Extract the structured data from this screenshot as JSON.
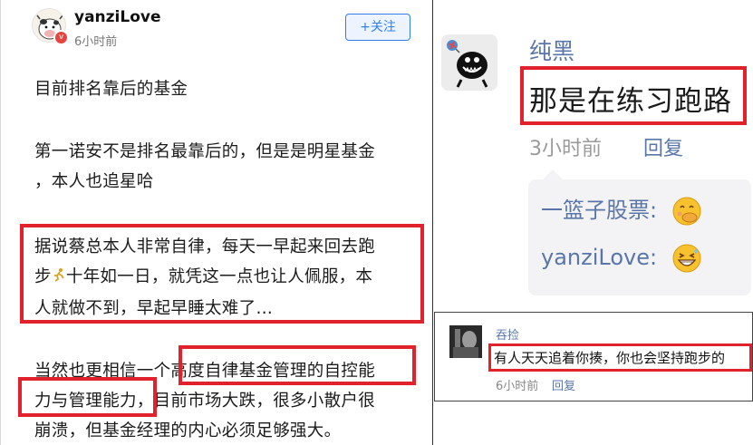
{
  "left_post": {
    "username": "yanziLove",
    "time": "6小时前",
    "follow_label": "+关注",
    "badge": "v",
    "paragraphs": {
      "p1": "目前排名靠后的基金",
      "p2_line1": "第一诺安不是排名最靠后的，但是是明星基金",
      "p2_line2": "，本人也追星哈",
      "p3_line1": "据说蔡总本人非常自律，每天一早起来回去跑",
      "p3_line2_a": "步",
      "p3_line2_b": "十年如一日，就凭这一点也让人佩服，本",
      "p3_line3": "人就做不到，早起早睡太难了…",
      "p4_line1": "当然也更相信一个高度自律基金管理的自控能",
      "p4_line2": "力与管理能力，目前市场大跌，很多小散户很",
      "p4_line3": "崩溃，但基金经理的内心必须足够强大。"
    },
    "icons": {
      "runner": "running-person-emoji"
    }
  },
  "comment_main": {
    "name": "纯黑",
    "text": "那是在练习跑路",
    "time": "3小时前",
    "reply_label": "回复",
    "replies": [
      {
        "text": "一篮子股票:",
        "emoji": "face-with-hand-over-mouth"
      },
      {
        "text": "yanziLove:",
        "emoji": "grinning-sweat-face"
      }
    ]
  },
  "comment_small": {
    "name": "吞捡",
    "text": "有人天天追着你揍，你也会坚持跑步的",
    "time": "6小时前",
    "reply_label": "回复"
  },
  "colors": {
    "highlight": "#e1212b",
    "link": "#5a76a8",
    "follow": "#2f7ff0"
  }
}
